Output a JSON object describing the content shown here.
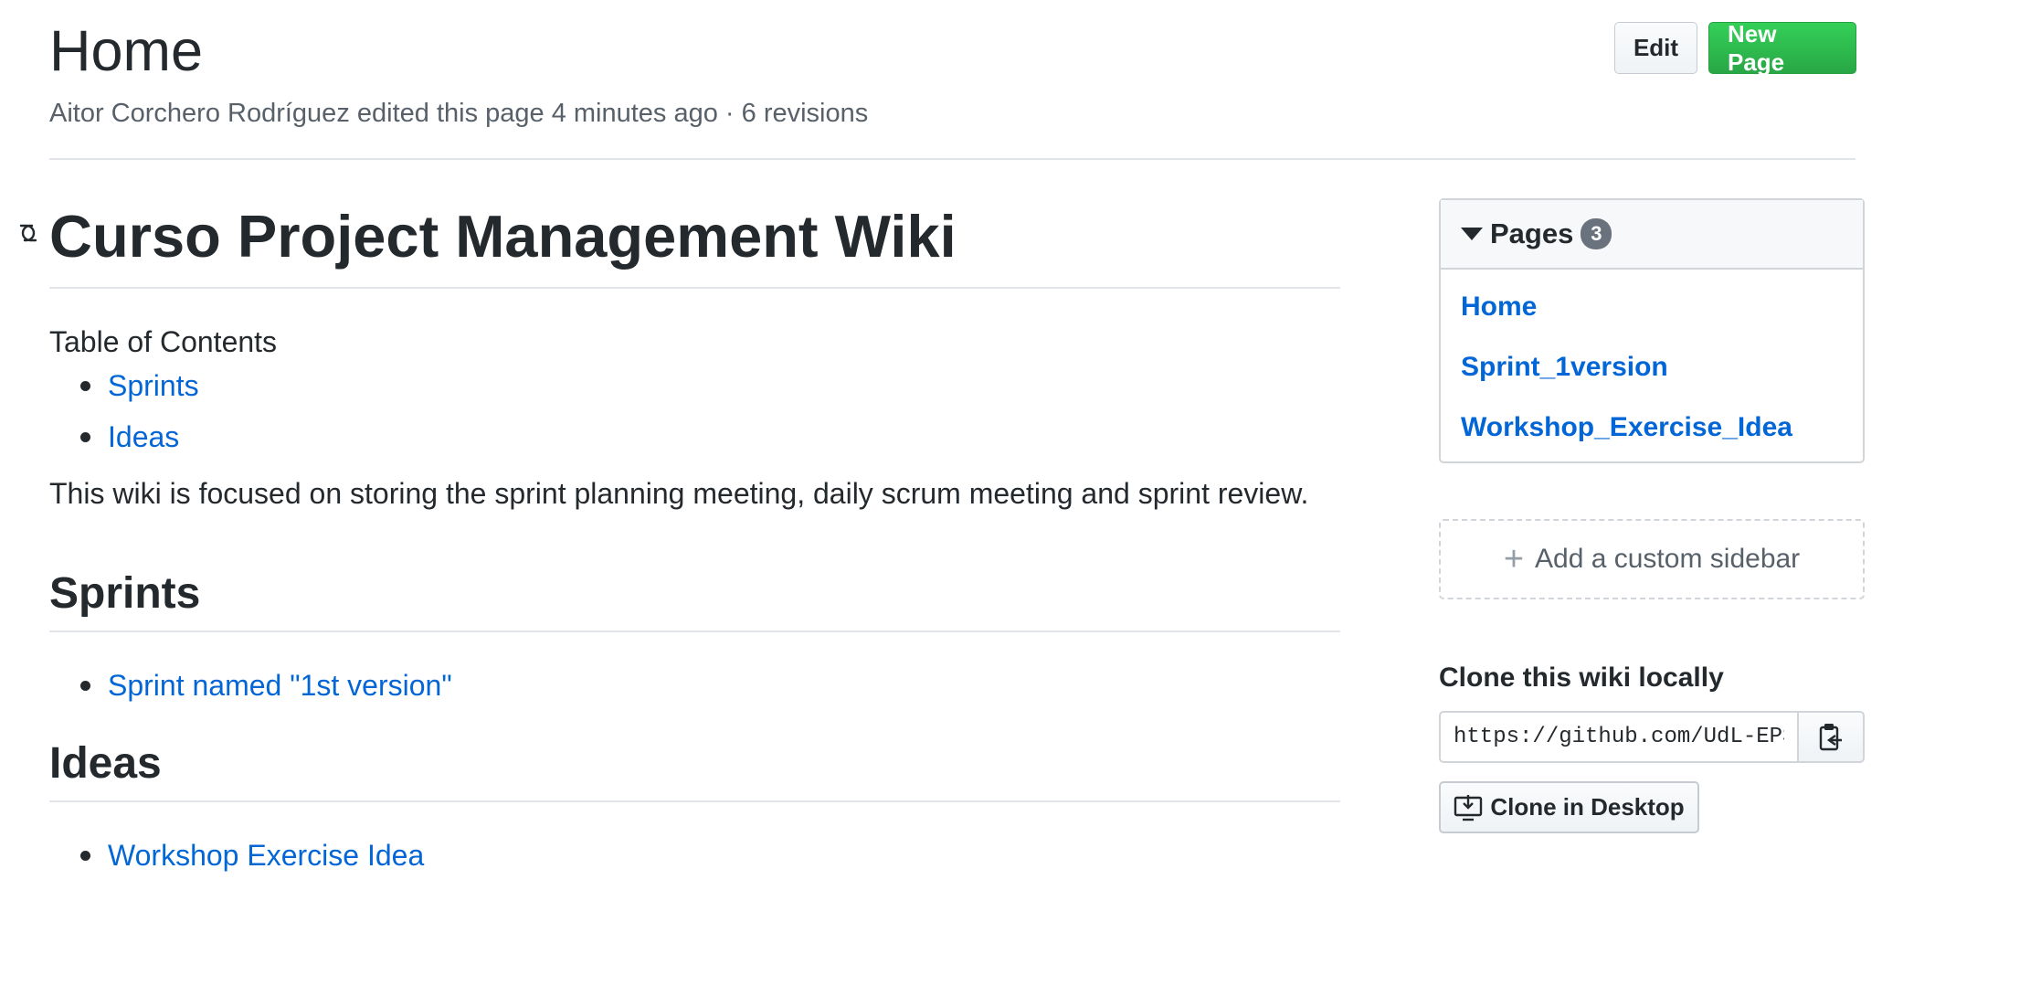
{
  "header": {
    "title": "Home",
    "meta": "Aitor Corchero Rodríguez edited this page 4 minutes ago · 6 revisions",
    "edit_label": "Edit",
    "new_page_label": "New Page"
  },
  "content": {
    "h1": "Curso Project Management Wiki",
    "toc_label": "Table of Contents",
    "toc_items": [
      "Sprints",
      "Ideas"
    ],
    "intro": "This wiki is focused on storing the sprint planning meeting, daily scrum meeting and sprint review.",
    "sprints_heading": "Sprints",
    "sprints_items": [
      "Sprint named \"1st version\""
    ],
    "ideas_heading": "Ideas",
    "ideas_items": [
      "Workshop Exercise Idea"
    ]
  },
  "sidebar": {
    "pages_label": "Pages",
    "pages_count": "3",
    "pages": [
      "Home",
      "Sprint_1version",
      "Workshop_Exercise_Idea"
    ],
    "custom_sidebar_label": "Add a custom sidebar",
    "clone_title": "Clone this wiki locally",
    "clone_url": "https://github.com/UdL-EPS-",
    "clone_desktop_label": "Clone in Desktop"
  },
  "colors": {
    "link": "#0366d6",
    "primary_button": "#28a745",
    "text": "#24292e",
    "muted": "#586069"
  },
  "icons": [
    "link-icon",
    "caret-down-icon",
    "plus-icon",
    "clipboard-icon",
    "desktop-download-icon"
  ]
}
